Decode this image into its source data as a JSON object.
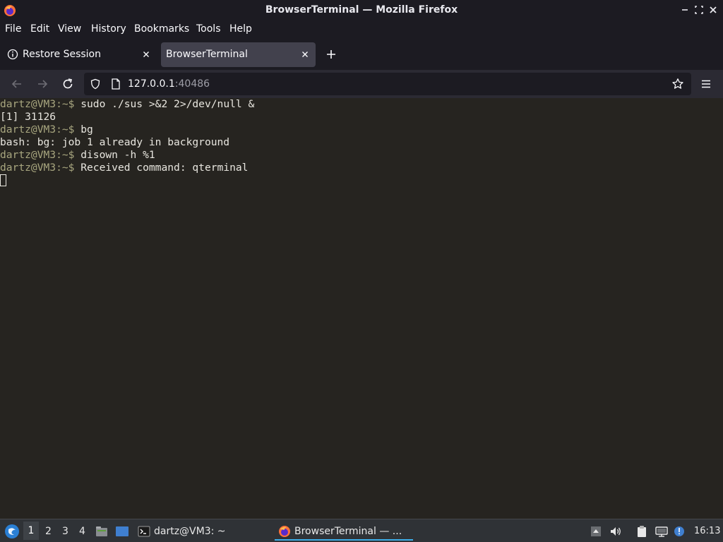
{
  "window": {
    "title": "BrowserTerminal — Mozilla Firefox",
    "icon": "firefox-icon"
  },
  "menu": [
    "File",
    "Edit",
    "View",
    "History",
    "Bookmarks",
    "Tools",
    "Help"
  ],
  "tabs": [
    {
      "label": "Restore Session",
      "icon": "info-icon",
      "active": false
    },
    {
      "label": "BrowserTerminal",
      "active": true
    }
  ],
  "urlbar": {
    "host": "127.0.0.1",
    "port": ":40486"
  },
  "terminal": {
    "lines": [
      {
        "prompt": "dartz@VM3:~$ ",
        "text": "sudo ./sus >&2 2>/dev/null &"
      },
      {
        "prompt": "",
        "text": "[1] 31126"
      },
      {
        "prompt": "dartz@VM3:~$ ",
        "text": "bg"
      },
      {
        "prompt": "",
        "text": "bash: bg: job 1 already in background"
      },
      {
        "prompt": "dartz@VM3:~$ ",
        "text": "disown -h %1"
      },
      {
        "prompt": "dartz@VM3:~$ ",
        "text": "Received command: qterminal"
      }
    ]
  },
  "taskbar": {
    "workspaces": [
      "1",
      "2",
      "3",
      "4"
    ],
    "active_workspace": "1",
    "windows": [
      {
        "label": "dartz@VM3: ~",
        "icon": "terminal-icon"
      },
      {
        "label": "BrowserTerminal — ...",
        "icon": "firefox-icon"
      }
    ],
    "clock": "16:13"
  },
  "colors": {
    "terminal_bg": "#262420",
    "prompt": "#a8a67f",
    "active_task_underline": "#3daee9"
  }
}
